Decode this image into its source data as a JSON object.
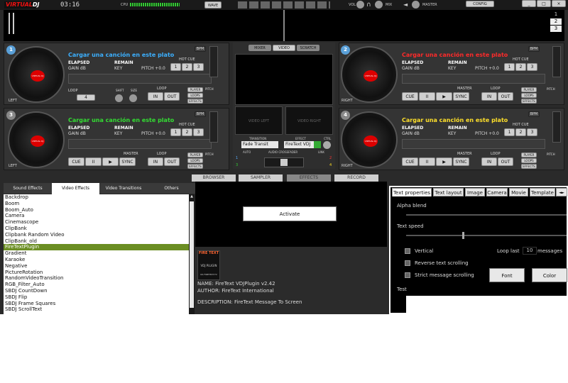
{
  "app": {
    "logo": "VIRTUALDJ",
    "clock": "03:16",
    "cpu": "CPU",
    "wave": "WAVE",
    "vol": "VOL",
    "mix": "MIX",
    "master": "MASTER",
    "config": "CONFIG"
  },
  "window": {
    "minimize": "_",
    "restore": "□",
    "close": "×"
  },
  "wave_nums": [
    "1",
    "2",
    "3"
  ],
  "decks": [
    {
      "num": "1",
      "title": "Cargar una canción en este plato",
      "title_color": "#3cb0ff",
      "side": "LEFT"
    },
    {
      "num": "2",
      "title": "Cargar una canción en este plato",
      "title_color": "#ff2a2a",
      "side": "RIGHT"
    },
    {
      "num": "3",
      "title": "Cargar una canción en este plato",
      "title_color": "#33dd33",
      "side": "LEFT"
    },
    {
      "num": "4",
      "title": "Cargar una canción en este plato",
      "title_color": "#ffe02a",
      "side": "RIGHT"
    }
  ],
  "deck_labels": {
    "elapsed": "ELAPSED",
    "remain": "REMAIN",
    "gain": "GAIN dB",
    "key": "KEY",
    "pitch": "PITCH +0.0",
    "hotcue": "HOT CUE",
    "bpm": "BPM",
    "loop": "LOOP",
    "shift": "SHIFT",
    "size": "SIZE",
    "master": "MASTER",
    "cue": "CUE",
    "pause": "II",
    "play": "▶",
    "sync": "SYNC",
    "in": "IN",
    "out": "OUT",
    "player": "PLAYER",
    "loops": "LOOPS",
    "effects": "EFFECTS",
    "pitch_lbl": "PITCH",
    "loop_val": "4",
    "label_text": "VIRTUAL DJ"
  },
  "mixer": {
    "tabs": [
      "MIXER",
      "VIDEO",
      "SCRATCH"
    ],
    "video_left": "VIDEO LEFT",
    "video_right": "VIDEO RIGHT",
    "transition": "TRANSITION",
    "effect": "EFFECT",
    "ctrl": "CTRL",
    "transition_val": "Fade Transit",
    "effect_val": "FireText VDJ",
    "auto": "AUTO",
    "crossfader": "AUDIO CROSSFADER",
    "link": "LINK",
    "nums": [
      "1",
      "2",
      "3",
      "4"
    ]
  },
  "bottom_tabs": [
    "BROWSER",
    "SAMPLER",
    "EFFECTS",
    "RECORD"
  ],
  "effect_tabs": [
    "Sound Effects",
    "Video Effects",
    "Video Transitions",
    "Others"
  ],
  "effects_list": [
    "Backdrop",
    "Boom",
    "Boom_Auto",
    "Camera",
    "Cinemascope",
    "ClipBank",
    "Clipbank Random Video",
    "ClipBank_old",
    "FireTextPlugin",
    "Gradient",
    "Karaoke",
    "Negative",
    "PictureRotation",
    "RandomVideoTransition",
    "RGB_Filter_Auto",
    "SBDJ CountDown",
    "SBDJ Flip",
    "SBDJ Frame Squares",
    "SBDJ ScrollText"
  ],
  "selected_index": 8,
  "activate": "Activate",
  "plugin": {
    "logo_top": "FIRE TEXT",
    "logo_sub": "VDJ PLUGIN",
    "logo_url": "UK.FIRETEXT.TV",
    "name": "NAME: FireText VDJPlugin v2.42",
    "author": "AUTHOR: FireText International",
    "desc": "DESCRIPTION: FireText Message To Screen"
  },
  "props": {
    "tabs": [
      "Text properties",
      "Text layout",
      "Image",
      "Camera",
      "Movie",
      "Template"
    ],
    "alpha": "Alpha blend",
    "speed": "Text speed",
    "speed_level": 0.35,
    "vertical": "Vertical",
    "reverse": "Reverse text scrolling",
    "strict": "Strict message scrolling",
    "loop_last": "Loop last",
    "loop_val": "10",
    "messages": "messages",
    "font": "Font",
    "color": "Color",
    "test": "Test"
  }
}
